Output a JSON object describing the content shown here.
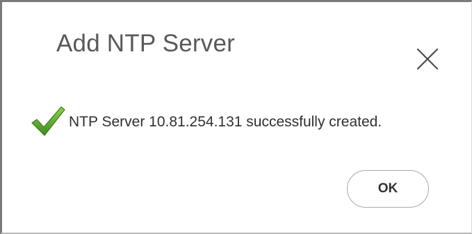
{
  "dialog": {
    "title": "Add NTP Server",
    "close_icon": "close-icon",
    "message": {
      "icon": "checkmark-icon",
      "icon_color": "#5aa12a",
      "text": "NTP Server 10.81.254.131 successfully created."
    },
    "ok_label": "OK"
  }
}
